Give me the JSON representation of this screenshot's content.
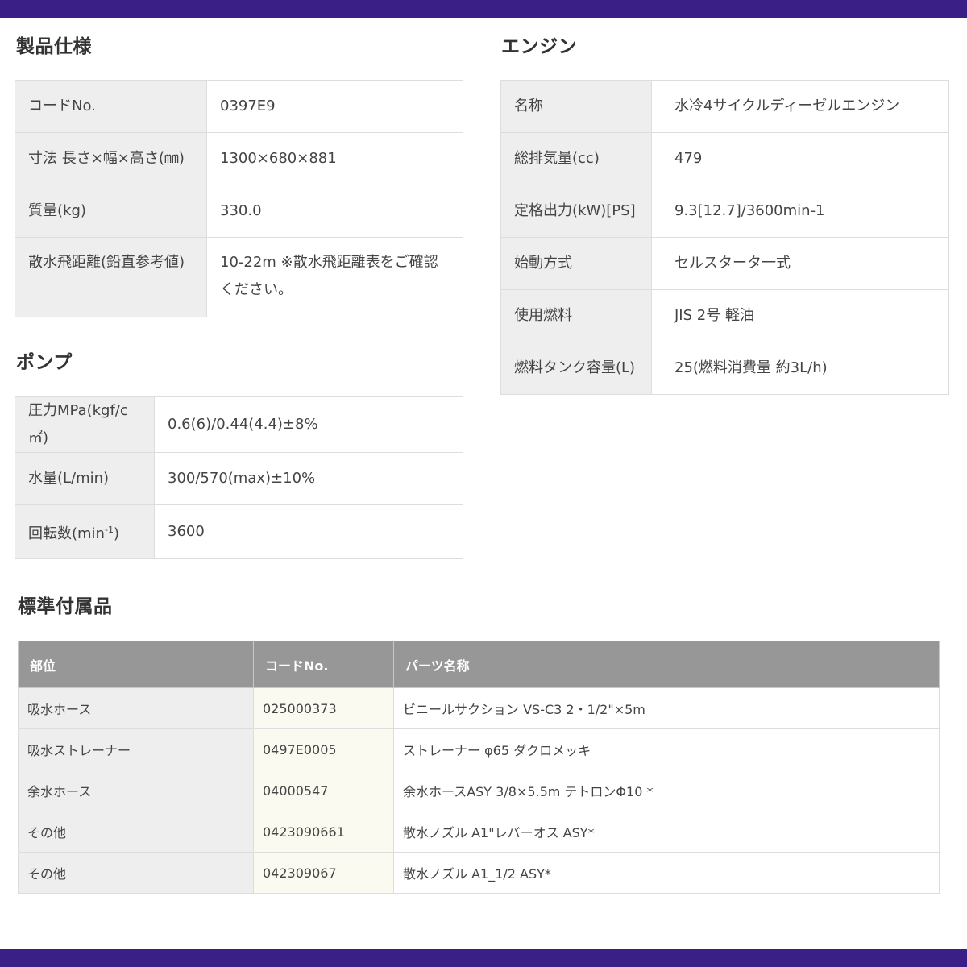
{
  "product_spec": {
    "title": "製品仕様",
    "rows": [
      {
        "label": "コードNo.",
        "value": "0397E9"
      },
      {
        "label": "寸法 長さ×幅×高さ(㎜)",
        "value": "1300×680×881"
      },
      {
        "label": "質量(kg)",
        "value": "330.0"
      },
      {
        "label": "散水飛距離(鉛直参考値)",
        "value": "10-22m ※散水飛距離表をご確認ください。"
      }
    ]
  },
  "engine": {
    "title": "エンジン",
    "rows": [
      {
        "label": "名称",
        "value": "水冷4サイクルディーゼルエンジン"
      },
      {
        "label": "総排気量(cc)",
        "value": "479"
      },
      {
        "label": "定格出力(kW)[PS]",
        "value": "9.3[12.7]/3600min-1"
      },
      {
        "label": "始動方式",
        "value": "セルスタータ一式"
      },
      {
        "label": "使用燃料",
        "value": "JIS 2号 軽油"
      },
      {
        "label": "燃料タンク容量(L)",
        "value": "25(燃料消費量 約3L/h)"
      }
    ]
  },
  "pump": {
    "title": "ポンプ",
    "rows": [
      {
        "label": "圧力MPa(kgf/c㎡)",
        "value": "0.6(6)/0.44(4.4)±8%"
      },
      {
        "label": "水量(L/min)",
        "value": "300/570(max)±10%"
      },
      {
        "label": "回転数(min",
        "label_sup": "-1",
        "label_end": ")",
        "value": "3600"
      }
    ]
  },
  "accessories": {
    "title": "標準付属品",
    "headers": [
      "部位",
      "コードNo.",
      "パーツ名称"
    ],
    "rows": [
      {
        "part": "吸水ホース",
        "code": "025000373",
        "name": "ビニールサクション VS-C3 2・1/2\"×5m"
      },
      {
        "part": "吸水ストレーナー",
        "code": "0497E0005",
        "name": "ストレーナー φ65 ダクロメッキ"
      },
      {
        "part": "余水ホース",
        "code": "04000547",
        "name": "余水ホースASY 3/8×5.5m テトロンΦ10 *"
      },
      {
        "part": "その他",
        "code": "0423090661",
        "name": "散水ノズル A1\"レバーオス ASY*"
      },
      {
        "part": "その他",
        "code": "042309067",
        "name": "散水ノズル A1_1/2 ASY*"
      }
    ]
  },
  "colors": {
    "accent_bar": "#3a1f86",
    "table_header": "#979797",
    "label_bg": "#eeeeee",
    "code_bg": "#fafaf0"
  }
}
